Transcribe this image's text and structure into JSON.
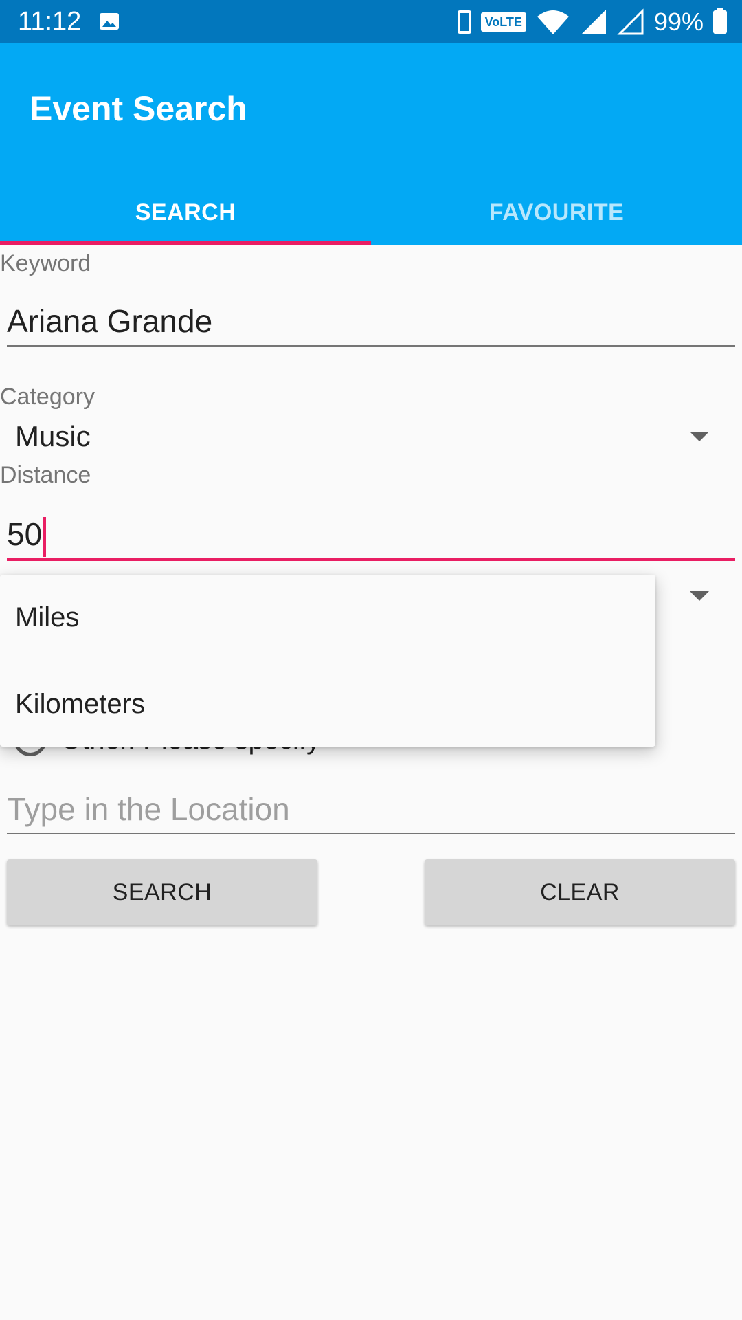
{
  "status_bar": {
    "time": "11:12",
    "network_badge": "VoLTE",
    "battery_text": "99%",
    "icons": [
      "image-icon",
      "phone-icon",
      "volte-icon",
      "wifi-icon",
      "signal-icon",
      "signal-empty-icon",
      "battery-icon"
    ]
  },
  "app_bar": {
    "title": "Event Search",
    "tabs": [
      {
        "label": "SEARCH",
        "selected": true
      },
      {
        "label": "FAVOURITE",
        "selected": false
      }
    ],
    "colors": {
      "primary": "#03a9f4",
      "status": "#0277bd",
      "accent": "#e91e63"
    }
  },
  "form": {
    "keyword": {
      "label": "Keyword",
      "value": "Ariana Grande"
    },
    "category": {
      "label": "Category",
      "value": "Music"
    },
    "distance": {
      "label": "Distance",
      "value": "50"
    },
    "location": {
      "placeholder": "Type in the Location"
    },
    "partially_hidden_radio_label": "Other. Please specify"
  },
  "unit_dropdown": {
    "options": [
      "Miles",
      "Kilometers"
    ]
  },
  "buttons": {
    "search": "SEARCH",
    "clear": "CLEAR"
  }
}
